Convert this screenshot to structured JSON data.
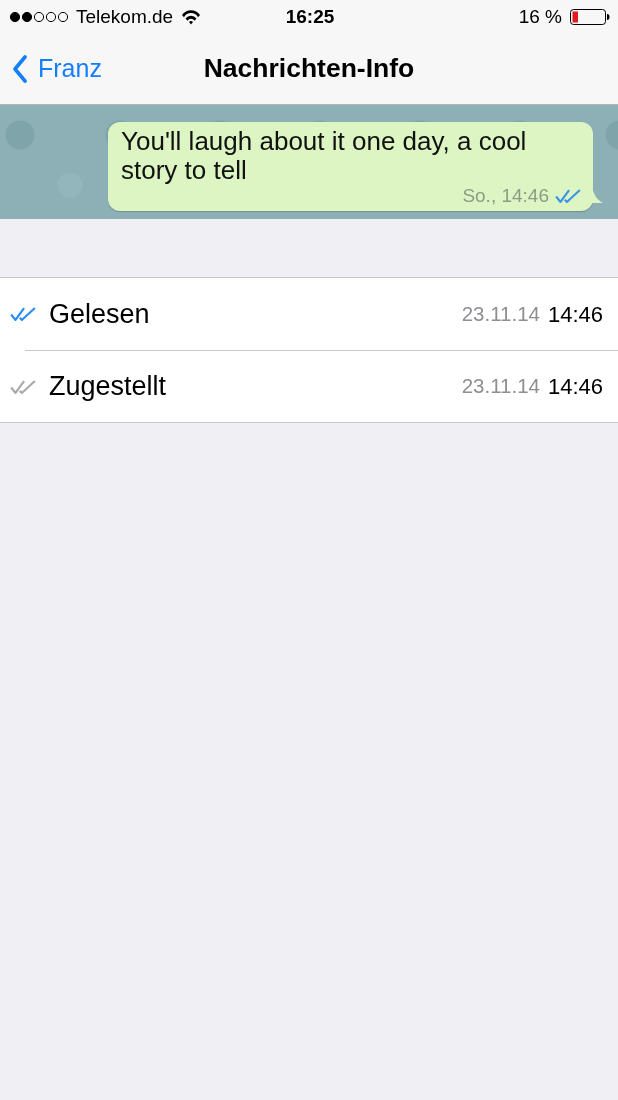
{
  "status_bar": {
    "carrier": "Telekom.de",
    "time": "16:25",
    "battery": "16 %"
  },
  "nav_bar": {
    "back": "Franz",
    "title": "Nachrichten-Info"
  },
  "message": {
    "text": "You'll laugh about it one day, a cool story to tell",
    "time": "So., 14:46",
    "read": true
  },
  "receipts": [
    {
      "label": "Gelesen",
      "date": "23.11.14",
      "time": "14:46",
      "color": "#2b8df2"
    },
    {
      "label": "Zugestellt",
      "date": "23.11.14",
      "time": "14:46",
      "color": "#a9a9ad"
    }
  ]
}
